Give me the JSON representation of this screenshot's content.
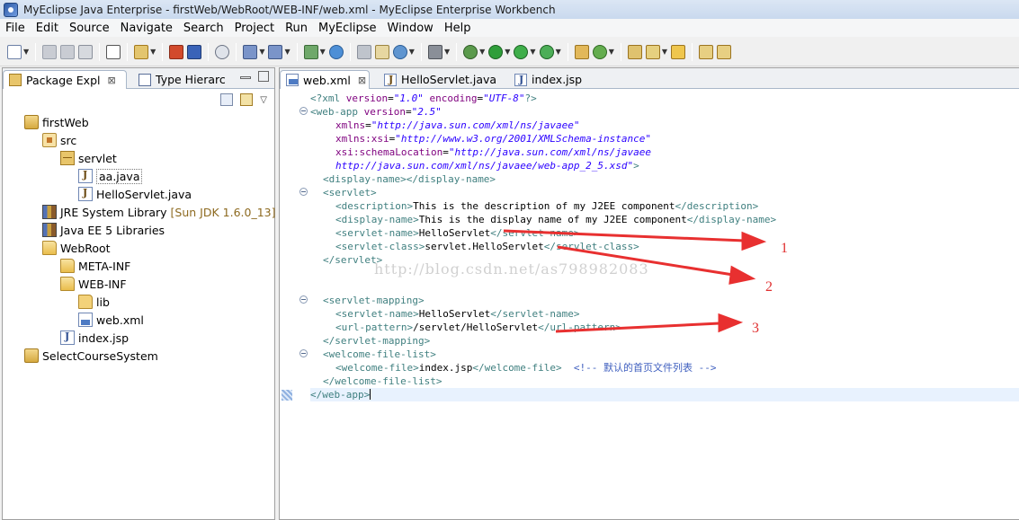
{
  "window": {
    "title": "MyEclipse Java Enterprise - firstWeb/WebRoot/WEB-INF/web.xml - MyEclipse Enterprise Workbench"
  },
  "menu": [
    "File",
    "Edit",
    "Source",
    "Navigate",
    "Search",
    "Project",
    "Run",
    "MyEclipse",
    "Window",
    "Help"
  ],
  "toolbar_icons": [
    "new-icon",
    "save-icon",
    "save-all-icon",
    "print-icon",
    "binary-icon",
    "open-type-icon",
    "box-icon",
    "module-icon",
    "deploy-icon",
    "wand-icon",
    "wand2-icon",
    "server-run-icon",
    "globe-icon",
    "cut-icon",
    "browser-icon",
    "globe2-icon",
    "camera-icon",
    "debug-icon",
    "run-icon",
    "run-external-icon",
    "coverage-icon",
    "new-package-icon",
    "refresh-icon",
    "open-folder-icon",
    "pencil-icon",
    "folder-open-icon",
    "nav-icon",
    "nav2-icon"
  ],
  "left_panel": {
    "tabs": [
      {
        "label": "Package Expl",
        "close": "⊠"
      },
      {
        "label": "Type Hierarc",
        "close": ""
      }
    ],
    "tree": [
      {
        "label": "firstWeb",
        "icon": "project-icon"
      },
      {
        "label": "src",
        "icon": "source-folder-icon"
      },
      {
        "label": "servlet",
        "icon": "package-icon"
      },
      {
        "label": "aa.java",
        "icon": "java-file-icon"
      },
      {
        "label": "HelloServlet.java",
        "icon": "java-file-icon"
      },
      {
        "label": "JRE System Library",
        "extra": "[Sun JDK 1.6.0_13]",
        "icon": "library-icon"
      },
      {
        "label": "Java EE 5 Libraries",
        "icon": "library-icon"
      },
      {
        "label": "WebRoot",
        "icon": "folder-open-icon"
      },
      {
        "label": "META-INF",
        "icon": "folder-open-icon"
      },
      {
        "label": "WEB-INF",
        "icon": "folder-open-icon"
      },
      {
        "label": "lib",
        "icon": "folder-icon"
      },
      {
        "label": "web.xml",
        "icon": "xml-file-icon"
      },
      {
        "label": "index.jsp",
        "icon": "jsp-file-icon"
      },
      {
        "label": "SelectCourseSystem",
        "icon": "project-icon"
      }
    ]
  },
  "editor": {
    "tabs": [
      {
        "label": "web.xml",
        "close": "⊠"
      },
      {
        "label": "HelloServlet.java",
        "close": ""
      },
      {
        "label": "index.jsp",
        "close": ""
      }
    ],
    "code": {
      "l1": {
        "pi": "<?xml ",
        "a1": "version",
        "eq1": "=",
        "v1": "\"1.0\"",
        "sp": " ",
        "a2": "encoding",
        "eq2": "=",
        "v2": "\"UTF-8\"",
        "end": "?>"
      },
      "l2": {
        "tag": "<web-app ",
        "attr": "version",
        "eq": "=",
        "val": "\"2.5\""
      },
      "l3": {
        "attr": "xmlns",
        "eq": "=",
        "val": "\"http://java.sun.com/xml/ns/javaee\""
      },
      "l4": {
        "attr": "xmlns:xsi",
        "eq": "=",
        "val": "\"http://www.w3.org/2001/XMLSchema-instance\""
      },
      "l5": {
        "attr": "xsi:schemaLocation",
        "eq": "=",
        "val": "\"http://java.sun.com/xml/ns/javaee"
      },
      "l6": {
        "val": "http://java.sun.com/xml/ns/javaee/web-app_2_5.xsd\"",
        "end": ">"
      },
      "l7": {
        "open": "<display-name>",
        "close": "</display-name>"
      },
      "l8": {
        "open": "<servlet>"
      },
      "l9": {
        "open": "<description>",
        "text": "This is the description of my J2EE component",
        "close": "</description>"
      },
      "l10": {
        "open": "<display-name>",
        "text": "This is the display name of my J2EE component",
        "close": "</display-name>"
      },
      "l11": {
        "open": "<servlet-name>",
        "text": "HelloServlet",
        "close": "</servlet-name>"
      },
      "l12": {
        "open": "<servlet-class>",
        "text": "servlet.HelloServlet",
        "close": "</servlet-class>"
      },
      "l13": {
        "close": "</servlet>"
      },
      "l15": {
        "open": "<servlet-mapping>"
      },
      "l16": {
        "open": "<servlet-name>",
        "text": "HelloServlet",
        "close": "</servlet-name>"
      },
      "l17": {
        "open": "<url-pattern>",
        "text": "/servlet/HelloServlet",
        "close": "</url-pattern>"
      },
      "l18": {
        "close": "</servlet-mapping>"
      },
      "l19": {
        "open": "<welcome-file-list>"
      },
      "l20": {
        "open": "<welcome-file>",
        "text": "index.jsp",
        "close": "</welcome-file>",
        "comment": "<!-- 默认的首页文件列表 -->"
      },
      "l21": {
        "close": "</welcome-file-list>"
      },
      "l22": {
        "close": "</web-app>"
      }
    },
    "watermark": "http://blog.csdn.net/as798982083"
  },
  "annotations": [
    {
      "label": "1",
      "color": "#e83030"
    },
    {
      "label": "2",
      "color": "#e83030"
    },
    {
      "label": "3",
      "color": "#e83030"
    }
  ]
}
